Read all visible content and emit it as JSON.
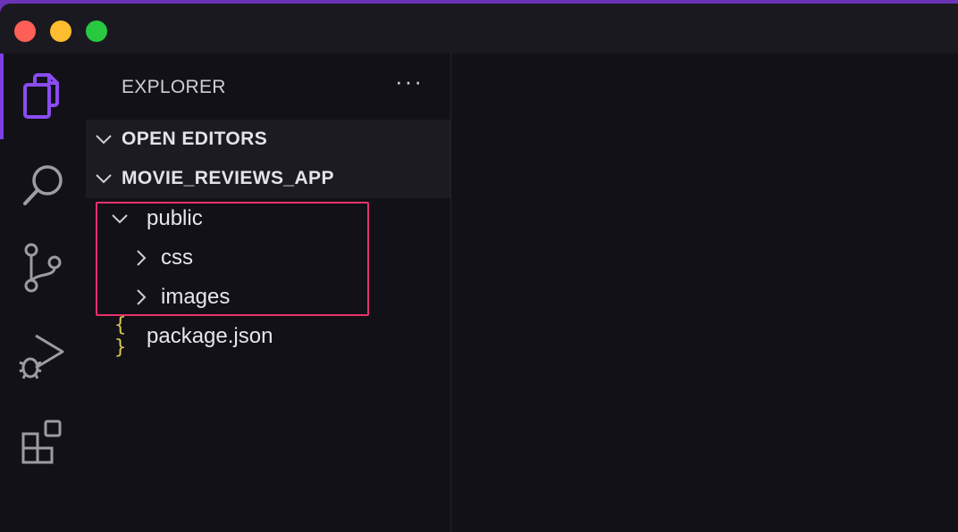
{
  "window": {
    "traffic_lights": [
      "close",
      "minimize",
      "zoom"
    ]
  },
  "activity_bar": {
    "items": [
      {
        "icon": "files-icon",
        "active": true
      },
      {
        "icon": "search-icon",
        "active": false
      },
      {
        "icon": "source-control-icon",
        "active": false
      },
      {
        "icon": "run-debug-icon",
        "active": false
      },
      {
        "icon": "extensions-icon",
        "active": false
      }
    ],
    "accent": "#7b3fe4"
  },
  "explorer": {
    "title": "EXPLORER",
    "more_label": "···",
    "sections": [
      {
        "label": "OPEN EDITORS",
        "expanded": true
      },
      {
        "label": "MOVIE_REVIEWS_APP",
        "expanded": true
      }
    ],
    "tree": [
      {
        "label": "public",
        "type": "folder",
        "expanded": true,
        "depth": 0
      },
      {
        "label": "css",
        "type": "folder",
        "expanded": false,
        "depth": 1
      },
      {
        "label": "images",
        "type": "folder",
        "expanded": false,
        "depth": 1
      },
      {
        "label": "package.json",
        "type": "file",
        "depth": 0,
        "file_icon": "{ }"
      }
    ],
    "highlight_color": "#e5326a"
  }
}
